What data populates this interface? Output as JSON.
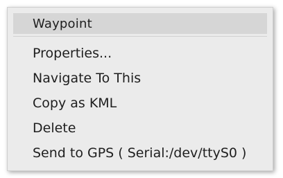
{
  "menu": {
    "header": "Waypoint",
    "items": [
      {
        "label": "Properties..."
      },
      {
        "label": "Navigate To This"
      },
      {
        "label": "Copy as KML"
      },
      {
        "label": "Delete"
      },
      {
        "label": "Send to GPS ( Serial:/dev/ttyS0 )"
      }
    ]
  }
}
